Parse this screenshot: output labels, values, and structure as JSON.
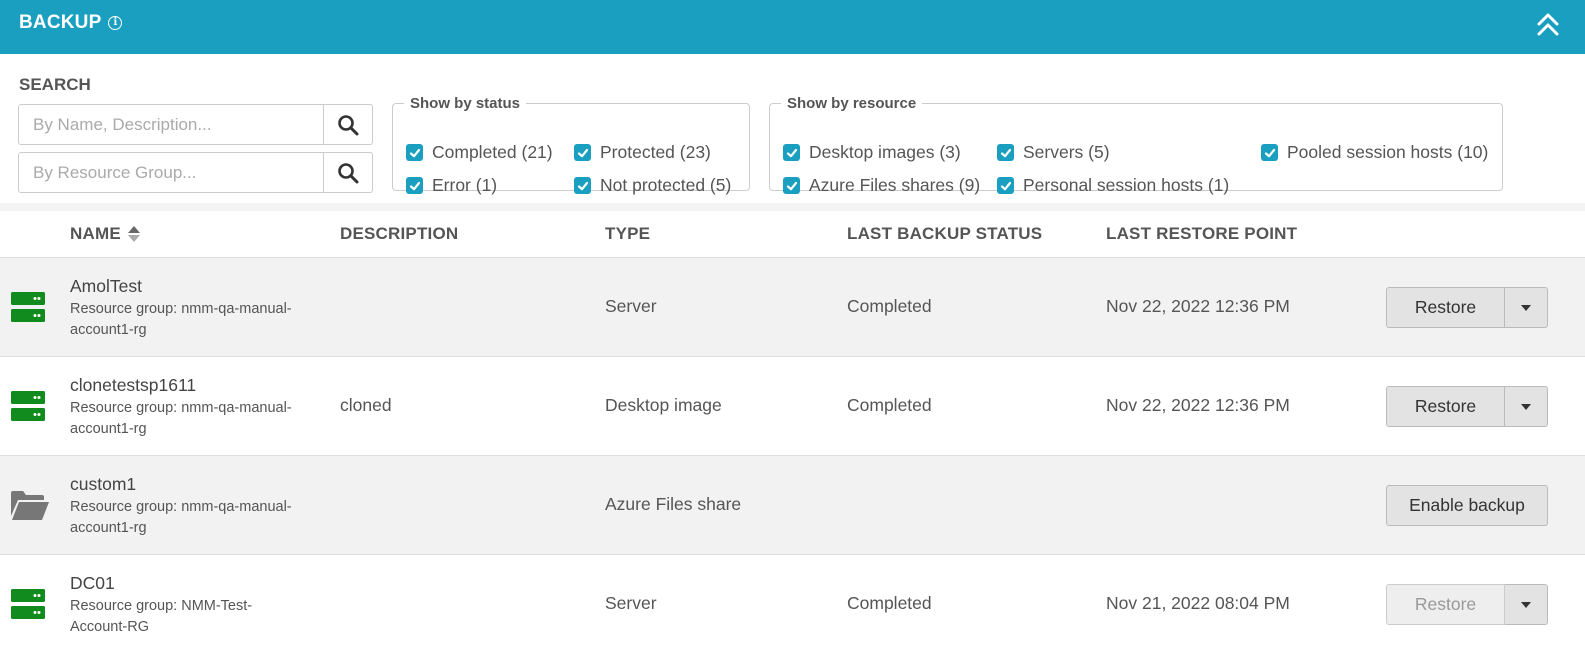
{
  "header": {
    "title": "BACKUP",
    "info_icon": "info-icon",
    "collapse_icon": "double-chevron-up-icon"
  },
  "search": {
    "label": "SEARCH",
    "name_placeholder": "By Name, Description...",
    "name_value": "",
    "group_placeholder": "By Resource Group...",
    "group_value": ""
  },
  "status_filter": {
    "legend": "Show by status",
    "items": [
      {
        "label": "Completed (21)",
        "checked": true
      },
      {
        "label": "Protected (23)",
        "checked": true
      },
      {
        "label": "Error (1)",
        "checked": true
      },
      {
        "label": "Not protected (5)",
        "checked": true
      }
    ]
  },
  "resource_filter": {
    "legend": "Show by resource",
    "items": [
      {
        "label": "Desktop images (3)",
        "checked": true
      },
      {
        "label": "Servers (5)",
        "checked": true
      },
      {
        "label": "Pooled session hosts (10)",
        "checked": true
      },
      {
        "label": "Azure Files shares (9)",
        "checked": true
      },
      {
        "label": "Personal session hosts (1)",
        "checked": true
      }
    ]
  },
  "table": {
    "columns": [
      "NAME",
      "DESCRIPTION",
      "TYPE",
      "LAST BACKUP STATUS",
      "LAST RESTORE POINT"
    ],
    "rows": [
      {
        "icon": "server-icon",
        "name": "AmolTest",
        "resource_group_line1": "Resource group: nmm-qa-manual-",
        "resource_group_line2": "account1-rg",
        "description": "",
        "type": "Server",
        "status": "Completed",
        "restore_point": "Nov 22, 2022 12:36 PM",
        "action": "Restore",
        "action_enabled": true
      },
      {
        "icon": "server-icon",
        "name": "clonetestsp1611",
        "resource_group_line1": "Resource group: nmm-qa-manual-",
        "resource_group_line2": "account1-rg",
        "description": "cloned",
        "type": "Desktop image",
        "status": "Completed",
        "restore_point": "Nov 22, 2022 12:36 PM",
        "action": "Restore",
        "action_enabled": true
      },
      {
        "icon": "folder-open-icon",
        "name": "custom1",
        "resource_group_line1": "Resource group: nmm-qa-manual-",
        "resource_group_line2": "account1-rg",
        "description": "",
        "type": "Azure Files share",
        "status": "",
        "restore_point": "",
        "action": "Enable backup",
        "action_enabled": true
      },
      {
        "icon": "server-icon",
        "name": "DC01",
        "resource_group_line1": "Resource group: NMM-Test-",
        "resource_group_line2": "Account-RG",
        "description": "",
        "type": "Server",
        "status": "Completed",
        "restore_point": "Nov 21, 2022 08:04 PM",
        "action": "Restore",
        "action_enabled": false
      }
    ]
  },
  "colors": {
    "accent": "#1b9fc1",
    "server_icon": "#118a1e",
    "folder_icon": "#777777"
  }
}
